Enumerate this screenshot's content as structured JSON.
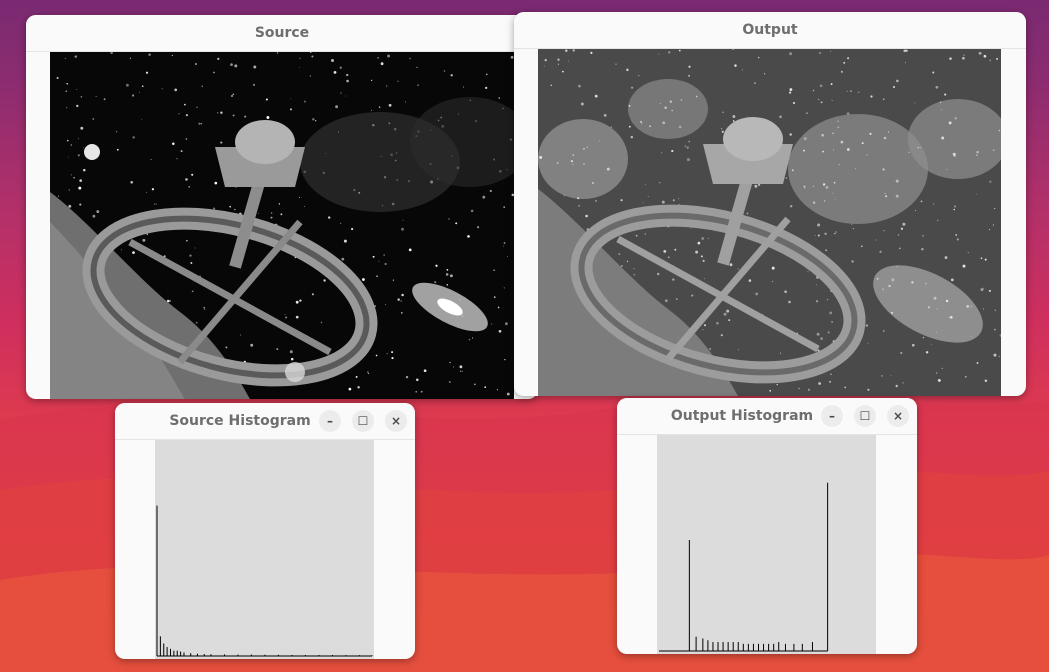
{
  "desktop": {
    "accent": "#c7315f"
  },
  "windows": {
    "source": {
      "title": "Source"
    },
    "output": {
      "title": "Output"
    },
    "source_histogram": {
      "title": "Source Histogram",
      "controls": {
        "minimize": "–",
        "maximize": "☐",
        "close": "×"
      }
    },
    "output_histogram": {
      "title": "Output Histogram",
      "controls": {
        "minimize": "–",
        "maximize": "☐",
        "close": "×"
      }
    }
  },
  "chart_data": [
    {
      "type": "bar",
      "series_name": "",
      "bins": [
        0,
        4,
        8,
        12,
        16,
        20,
        24,
        28,
        32,
        40,
        48,
        56,
        64,
        80,
        96,
        112,
        128,
        144,
        160,
        176,
        192,
        208,
        224,
        240,
        255
      ],
      "values": [
        0.84,
        0.11,
        0.07,
        0.05,
        0.04,
        0.03,
        0.03,
        0.025,
        0.02,
        0.016,
        0.013,
        0.011,
        0.01,
        0.009,
        0.008,
        0.008,
        0.007,
        0.007,
        0.006,
        0.006,
        0.006,
        0.006,
        0.005,
        0.005,
        0.004
      ],
      "xlim": [
        0,
        255
      ],
      "ylim": [
        0,
        1
      ]
    },
    {
      "type": "bar",
      "series_name": "",
      "bins": [
        0,
        36,
        44,
        52,
        58,
        64,
        70,
        76,
        82,
        88,
        94,
        100,
        106,
        112,
        118,
        124,
        130,
        136,
        142,
        150,
        160,
        170,
        182,
        194,
        200
      ],
      "values": [
        0,
        0.62,
        0.08,
        0.07,
        0.06,
        0.05,
        0.05,
        0.05,
        0.05,
        0.05,
        0.05,
        0.04,
        0.04,
        0.04,
        0.04,
        0.04,
        0.04,
        0.04,
        0.05,
        0.04,
        0.04,
        0.04,
        0.05,
        0.0,
        0.94
      ],
      "xlim": [
        0,
        255
      ],
      "ylim": [
        0,
        1
      ]
    }
  ]
}
